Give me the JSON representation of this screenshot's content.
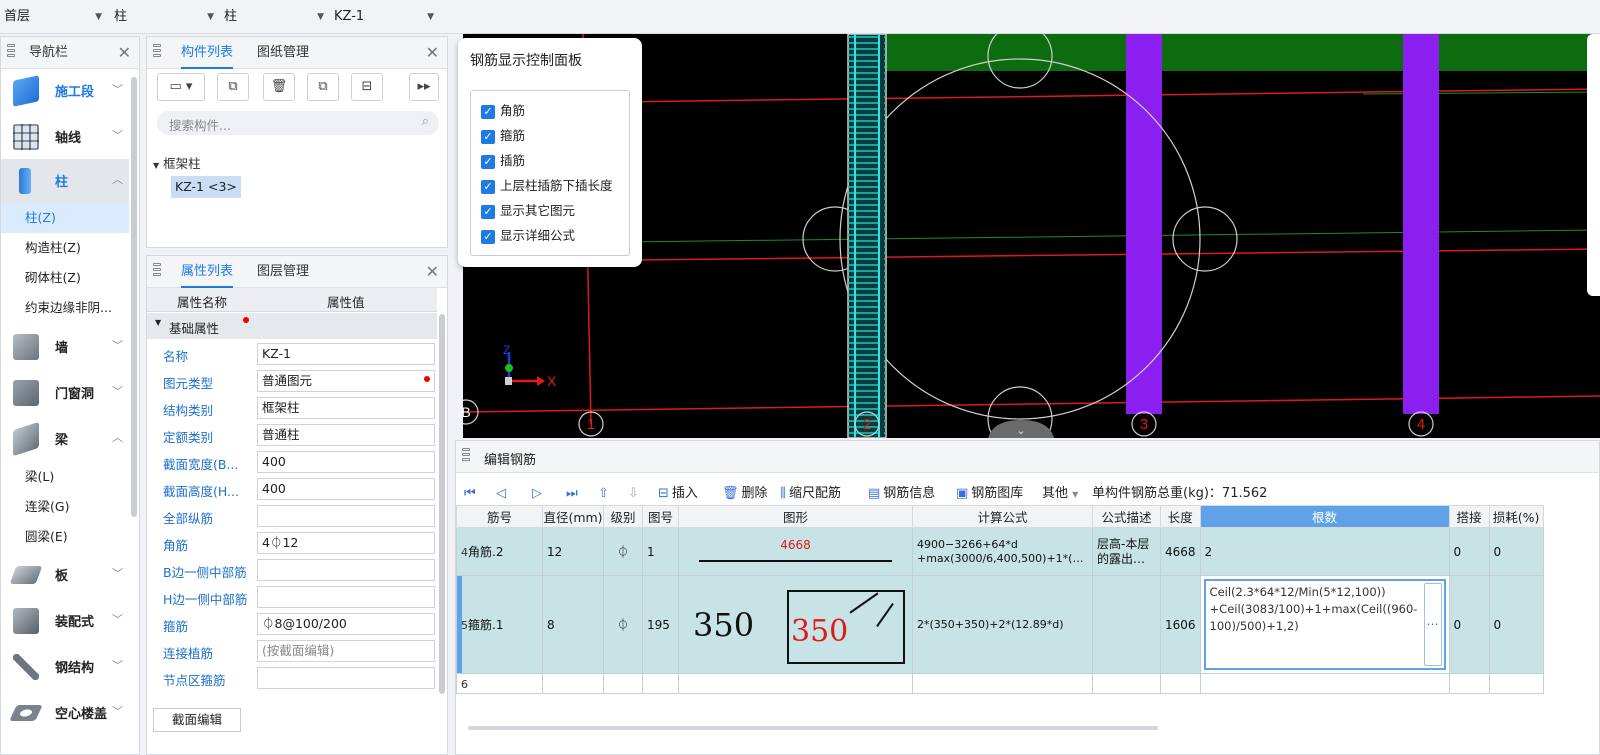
{
  "filters": [
    "首层",
    "柱",
    "柱",
    "KZ-1"
  ],
  "nav": {
    "title": "导航栏",
    "categories": [
      {
        "label": "施工段",
        "icon": "construction-segment-icon",
        "color": "#3b86e0"
      },
      {
        "label": "轴线",
        "icon": "axis-grid-icon",
        "color": "#7f8fa6"
      },
      {
        "label": "柱",
        "icon": "column-icon",
        "color": "#2f7fe3"
      },
      {
        "label": "墙",
        "icon": "wall-icon",
        "color": "#8a939e"
      },
      {
        "label": "门窗洞",
        "icon": "door-window-icon",
        "color": "#8a939e"
      },
      {
        "label": "梁",
        "icon": "beam-icon",
        "color": "#8a939e"
      },
      {
        "label": "板",
        "icon": "slab-icon",
        "color": "#8a939e"
      },
      {
        "label": "装配式",
        "icon": "prefab-icon",
        "color": "#8a939e"
      },
      {
        "label": "钢结构",
        "icon": "steel-structure-icon",
        "color": "#8a939e"
      },
      {
        "label": "空心楼盖",
        "icon": "hollow-floor-icon",
        "color": "#8a939e"
      }
    ],
    "column_items": [
      "柱(Z)",
      "构造柱(Z)",
      "砌体柱(Z)",
      "约束边缘非阴..."
    ],
    "beam_items": [
      "梁(L)",
      "连梁(G)",
      "圆梁(E)"
    ]
  },
  "comp": {
    "tabs": [
      "构件列表",
      "图纸管理"
    ],
    "search_placeholder": "搜索构件...",
    "tree_root": "框架柱",
    "tree_item": "KZ-1 <3>"
  },
  "props": {
    "tabs": [
      "属性列表",
      "图层管理"
    ],
    "header_name": "属性名称",
    "header_value": "属性值",
    "group": "基础属性",
    "rows": [
      {
        "name": "名称",
        "value": "KZ-1"
      },
      {
        "name": "图元类型",
        "value": "普通图元"
      },
      {
        "name": "结构类别",
        "value": "框架柱"
      },
      {
        "name": "定额类别",
        "value": "普通柱"
      },
      {
        "name": "截面宽度(B...",
        "value": "400"
      },
      {
        "name": "截面高度(H...",
        "value": "400"
      },
      {
        "name": "全部纵筋",
        "value": ""
      },
      {
        "name": "角筋",
        "value": "4⏀12"
      },
      {
        "name": "B边一侧中部筋",
        "value": ""
      },
      {
        "name": "H边一侧中部筋",
        "value": ""
      },
      {
        "name": "箍筋",
        "value": "⏀8@100/200"
      },
      {
        "name": "连接植筋",
        "value": "(按截面编辑)"
      },
      {
        "name": "节点区箍筋",
        "value": ""
      }
    ],
    "section_edit": "截面编辑"
  },
  "control_panel": {
    "title": "钢筋显示控制面板",
    "options": [
      "角筋",
      "箍筋",
      "插筋",
      "上层柱插筋下插长度",
      "显示其它图元",
      "显示详细公式"
    ]
  },
  "canvas": {
    "axis_labels": [
      "1",
      "2",
      "3",
      "4"
    ],
    "row_label": "B",
    "x_axis": "X",
    "z_axis": "Z"
  },
  "editor": {
    "title": "编辑钢筋",
    "tools": [
      "插入",
      "删除",
      "缩尺配筋",
      "钢筋信息",
      "钢筋图库",
      "其他"
    ],
    "total_weight": "单构件钢筋总重(kg)：71.562",
    "columns": [
      "筋号",
      "直径(mm)",
      "级别",
      "图号",
      "图形",
      "计算公式",
      "公式描述",
      "长度",
      "根数",
      "搭接",
      "损耗(%)"
    ],
    "rows": [
      {
        "num": "4",
        "name": "角筋.2",
        "diameter": "12",
        "grade": "⏀",
        "fig": "1",
        "shape_label": "4668",
        "formula1": "4900−3266+64*d",
        "formula2": "+max(3000/6,400,500)+1*(…",
        "desc": "层高-本层的露出…",
        "length": "4668",
        "count": "2",
        "lap": "0",
        "loss": "0"
      },
      {
        "num": "5",
        "name": "箍筋.1",
        "diameter": "8",
        "grade": "⏀",
        "fig": "195",
        "shape_left": "350",
        "shape_inner": "350",
        "formula1": "2*(350+350)+2*(12.89*d)",
        "desc": "",
        "length": "1606",
        "count": "Ceil(2.3*64*12/Min(5*12,100)) +Ceil(3083/100)+1+max(Ceil((960-100)/500)+1,2)",
        "lap": "0",
        "loss": "0"
      },
      {
        "num": "6"
      }
    ]
  }
}
